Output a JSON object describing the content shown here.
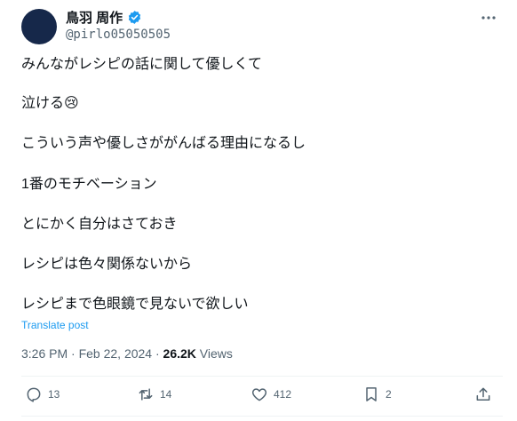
{
  "author": {
    "name": "鳥羽 周作",
    "handle": "@pirlo05050505"
  },
  "tweet": {
    "paragraphs": [
      "みんながレシピの話に関して優しくて",
      "泣ける😢",
      "こういう声や優しさががんばる理由になるし",
      "1番のモチベーション",
      "とにかく自分はさておき",
      "レシピは色々関係ないから",
      "レシピまで色眼鏡で見ないで欲しい"
    ],
    "translate_label": "Translate post",
    "timestamp": "3:26 PM · Feb 22, 2024 · ",
    "views_count": "26.2K",
    "views_label": " Views"
  },
  "actions": {
    "replies": "13",
    "reposts": "14",
    "likes": "412",
    "bookmarks": "2"
  },
  "colors": {
    "accent": "#1d9bf0",
    "secondary_text": "#536471",
    "avatar": "#16284a"
  }
}
